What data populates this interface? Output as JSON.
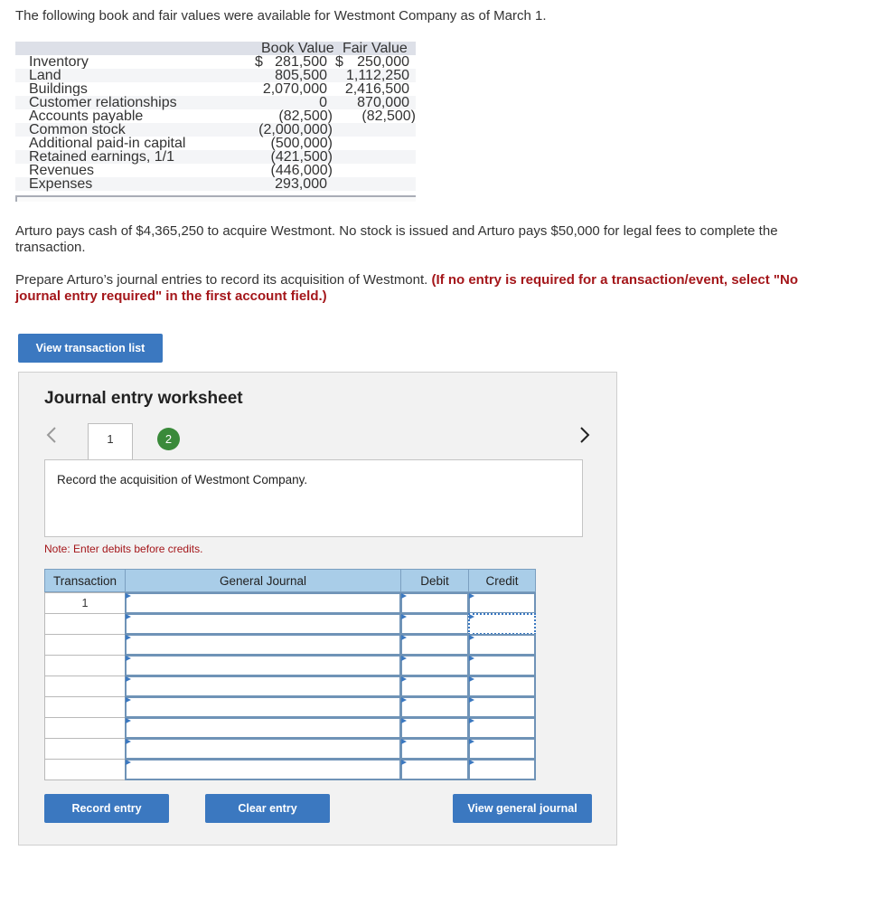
{
  "intro": "The following book and fair values were available for Westmont Company as of March 1.",
  "values_table": {
    "headers": {
      "book": "Book Value",
      "fair": "Fair Value"
    },
    "rows": [
      {
        "account": "Inventory",
        "book": "281,500",
        "fair": "250,000",
        "book_prefix": "$",
        "fair_prefix": "$"
      },
      {
        "account": "Land",
        "book": "805,500",
        "fair": "1,112,250"
      },
      {
        "account": "Buildings",
        "book": "2,070,000",
        "fair": "2,416,500"
      },
      {
        "account": "Customer relationships",
        "book": "0",
        "fair": "870,000"
      },
      {
        "account": "Accounts payable",
        "book": "(82,500)",
        "fair": "(82,500)"
      },
      {
        "account": "Common stock",
        "book": "(2,000,000)",
        "fair": ""
      },
      {
        "account": "Additional paid-in capital",
        "book": "(500,000)",
        "fair": ""
      },
      {
        "account": "Retained earnings, 1/1",
        "book": "(421,500)",
        "fair": ""
      },
      {
        "account": "Revenues",
        "book": "(446,000)",
        "fair": ""
      },
      {
        "account": "Expenses",
        "book": "293,000",
        "fair": ""
      }
    ]
  },
  "paragraph1": "Arturo pays cash of $4,365,250 to acquire Westmont. No stock is issued and Arturo pays $50,000 for legal fees to complete the transaction.",
  "paragraph2": {
    "text": "Prepare Arturo’s journal entries to record its acquisition of Westmont.",
    "instruction": "(If no entry is required for a transaction/event, select \"No journal entry required\" in the first account field.)"
  },
  "view_transaction_list": "View transaction list",
  "worksheet": {
    "title": "Journal entry worksheet",
    "prev_icon": "chevron-left-icon",
    "next_icon": "chevron-right-icon",
    "tabs": [
      "1",
      "2"
    ],
    "description": "Record the acquisition of Westmont Company.",
    "note": "Note: Enter debits before credits.",
    "columns": {
      "transaction": "Transaction",
      "general_journal": "General Journal",
      "debit": "Debit",
      "credit": "Credit"
    },
    "rows": [
      {
        "transaction": "1"
      },
      {
        "transaction": ""
      },
      {
        "transaction": ""
      },
      {
        "transaction": ""
      },
      {
        "transaction": ""
      },
      {
        "transaction": ""
      },
      {
        "transaction": ""
      },
      {
        "transaction": ""
      },
      {
        "transaction": ""
      }
    ],
    "buttons": {
      "record": "Record entry",
      "clear": "Clear entry",
      "view_journal": "View general journal"
    }
  },
  "colors": {
    "accent": "#3b78c0",
    "header_blue": "#a9cde8",
    "instruction_red": "#a4161a",
    "tab_green": "#3a8a3a"
  }
}
